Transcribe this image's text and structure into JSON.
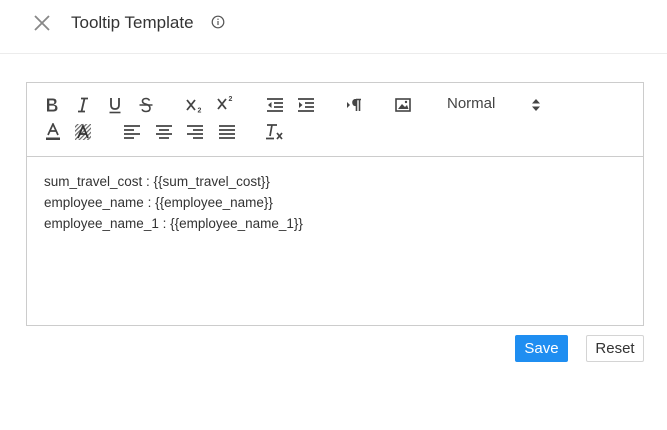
{
  "dialog": {
    "title": "Tooltip Template",
    "close_icon": "close-icon",
    "info_icon": "info-icon"
  },
  "toolbar": {
    "buttons_row1": [
      "bold-icon",
      "italic-icon",
      "underline-icon",
      "strikethrough-icon",
      "subscript-icon",
      "superscript-icon",
      "indent-decrease-icon",
      "indent-increase-icon",
      "text-direction-icon",
      "image-icon"
    ],
    "header_select": {
      "selected": "Normal"
    },
    "buttons_row2": [
      "text-color-icon",
      "background-color-icon",
      "align-left-icon",
      "align-center-icon",
      "align-right-icon",
      "align-justify-icon",
      "clear-format-icon"
    ]
  },
  "editor": {
    "lines": [
      "sum_travel_cost : {{sum_travel_cost}}",
      "employee_name : {{employee_name}}",
      "employee_name_1 : {{employee_name_1}}"
    ]
  },
  "actions": {
    "save_label": "Save",
    "reset_label": "Reset"
  },
  "colors": {
    "primary": "#1f8ef1",
    "border": "#cccccc",
    "text": "#333333"
  }
}
